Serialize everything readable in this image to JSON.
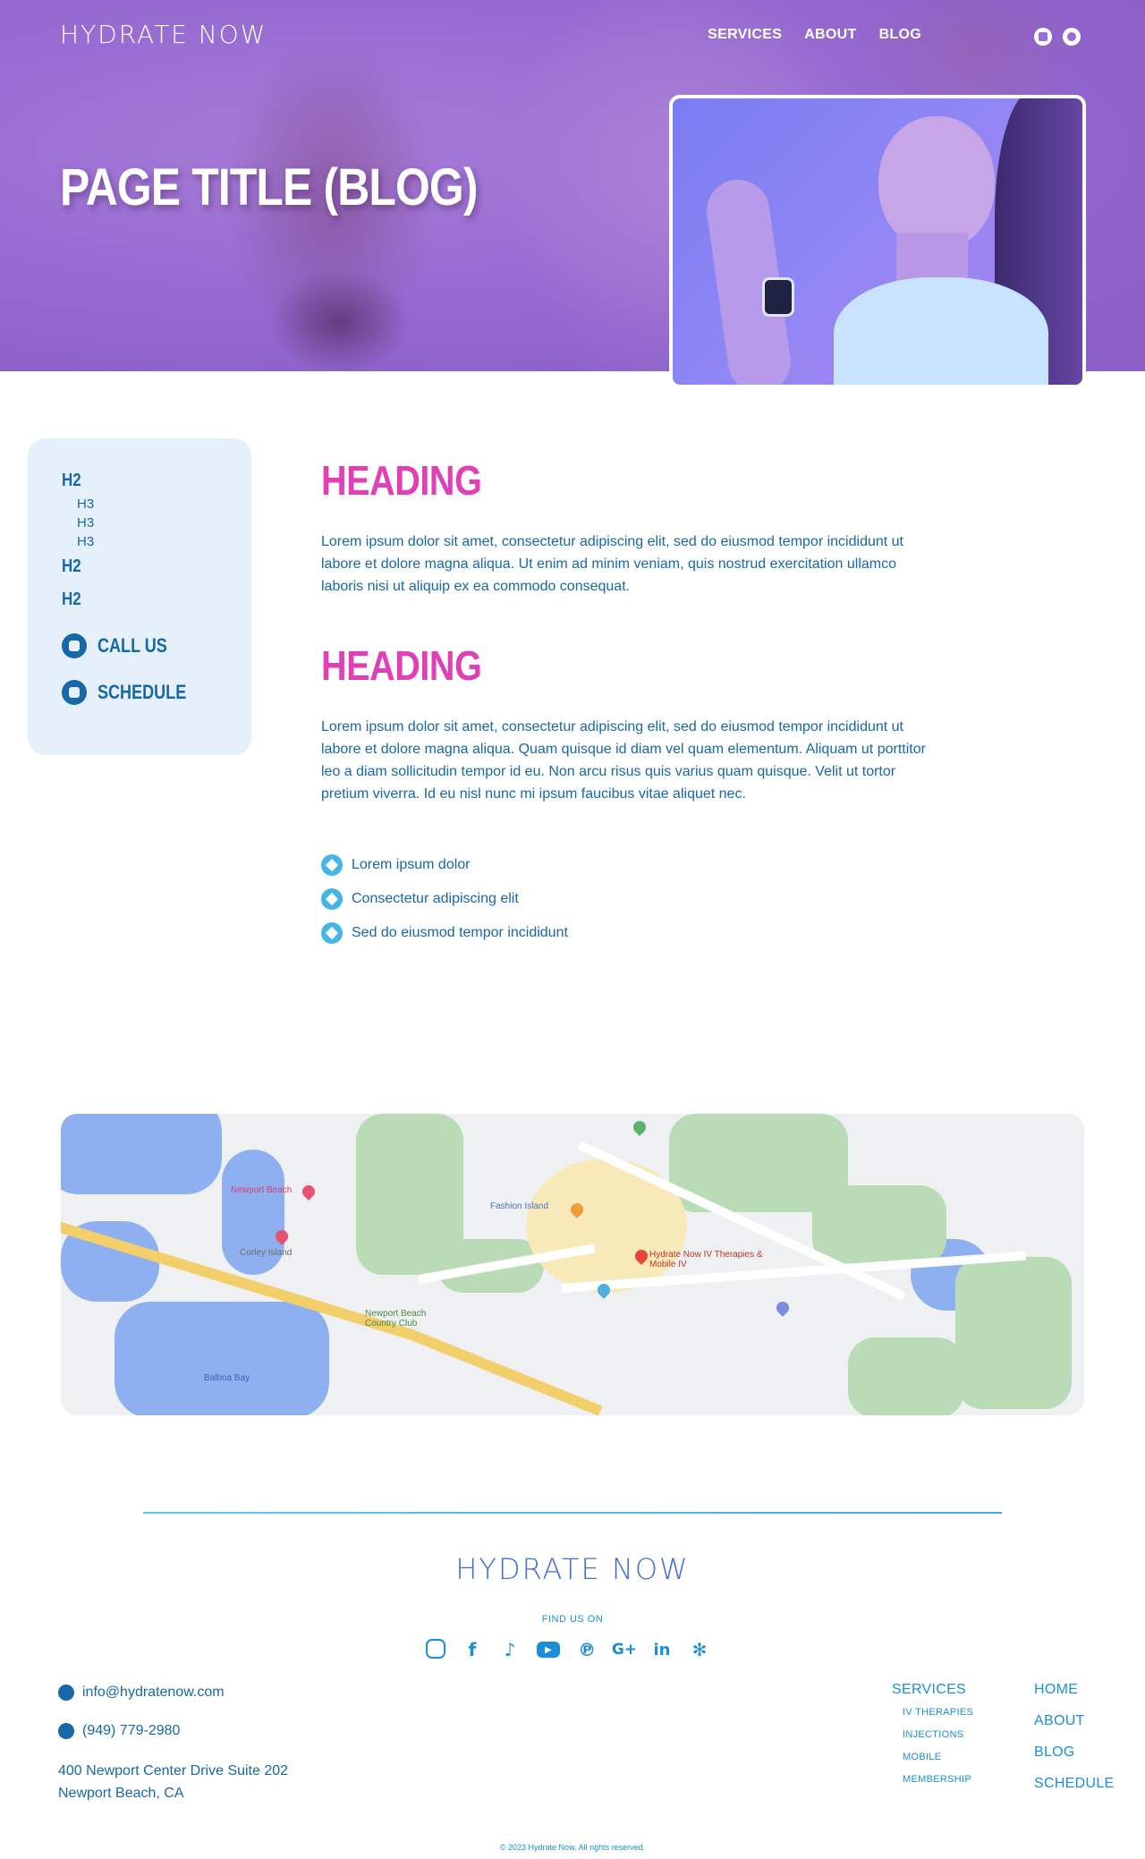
{
  "header": {
    "logo": "HYDRATE NOW",
    "nav": [
      "SERVICES",
      "ABOUT",
      "BLOG"
    ],
    "icons": [
      "calendar-icon",
      "whatsapp-icon"
    ]
  },
  "hero": {
    "title": "PAGE TITLE (BLOG)"
  },
  "toc": {
    "h2_1": "H2",
    "h3": [
      "H3",
      "H3",
      "H3"
    ],
    "h2_2": "H2",
    "h2_3": "H2",
    "call_label": "CALL US",
    "schedule_label": "SCHEDULE"
  },
  "main": {
    "section1": {
      "heading": "HEADING",
      "paragraph": "Lorem ipsum dolor sit amet, consectetur adipiscing elit, sed do eiusmod tempor incididunt ut labore et dolore magna aliqua. Ut enim ad minim veniam, quis nostrud exercitation ullamco laboris nisi ut aliquip ex ea commodo consequat."
    },
    "section2": {
      "heading": "HEADING",
      "paragraph": "Lorem ipsum dolor sit amet, consectetur adipiscing elit, sed do eiusmod tempor incididunt ut labore et dolore magna aliqua. Quam quisque id diam vel quam elementum. Aliquam ut porttitor leo a diam sollicitudin tempor id eu. Non arcu risus quis varius quam quisque. Velit ut tortor pretium viverra. Id eu nisl nunc mi ipsum faucibus vitae aliquet nec.",
      "bullets": [
        "Lorem ipsum dolor",
        "Consectetur adipiscing elit",
        "Sed do eiusmod tempor incididunt"
      ]
    }
  },
  "map": {
    "labels": [
      "Newport Beach",
      "Corley Island",
      "Fashion Island",
      "Hydrate Now IV Therapies & Mobile IV",
      "Newport Beach Country Club",
      "Balboa Bay"
    ]
  },
  "footer": {
    "logo": "HYDRATE NOW",
    "find_us": "FIND US ON",
    "socials": [
      "instagram-icon",
      "facebook-icon",
      "tiktok-icon",
      "youtube-icon",
      "pinterest-icon",
      "google-plus-icon",
      "linkedin-icon",
      "yelp-icon"
    ],
    "email": "info@hydratenow.com",
    "phone": "(949) 779-2980",
    "address_line1": "400 Newport Center Drive Suite 202",
    "address_line2": "Newport Beach, CA",
    "services": {
      "label": "SERVICES",
      "items": [
        "IV THERAPIES",
        "INJECTIONS",
        "MOBILE",
        "MEMBERSHIP"
      ]
    },
    "links": [
      "HOME",
      "ABOUT",
      "BLOG",
      "SCHEDULE"
    ],
    "copyright": "© 2023 Hydrate Now. All rights reserved."
  },
  "colors": {
    "hero_purple": "#9a6fd3",
    "heading_pink": "#e03fb5",
    "text_blue": "#1668a8",
    "accent_cyan": "#45b5e8",
    "sidebar_bg": "#e6f0fa"
  }
}
